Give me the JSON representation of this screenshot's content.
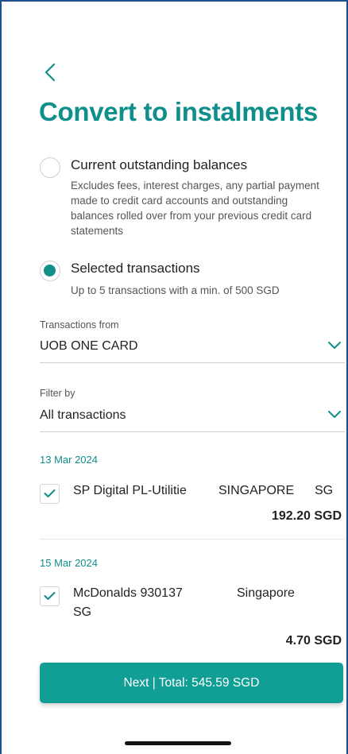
{
  "header": {
    "back_icon": "chevron-left-icon",
    "title": "Convert to instalments"
  },
  "options": [
    {
      "label": "Current outstanding balances",
      "description": "Excludes fees, interest charges, any partial payment made to credit card accounts and outstanding balances rolled over from your previous credit card statements",
      "selected": false
    },
    {
      "label": "Selected transactions",
      "description": "Up to 5 transactions with a min. of 500 SGD",
      "selected": true
    }
  ],
  "transactions_from": {
    "label": "Transactions from",
    "value": "UOB ONE CARD"
  },
  "filter": {
    "label": "Filter by",
    "value": "All transactions"
  },
  "transactions": [
    {
      "date": "13 Mar 2024",
      "merchant": "SP Digital PL-Utilitie",
      "location": "SINGAPORE",
      "country": "SG",
      "amount": "192.20 SGD",
      "checked": true
    },
    {
      "date": "15 Mar 2024",
      "merchant": "McDonalds 930137",
      "location": "Singapore",
      "country": "SG",
      "amount": "4.70 SGD",
      "checked": true
    }
  ],
  "footer": {
    "next_label": "Next | Total: 545.59 SGD"
  },
  "colors": {
    "accent": "#0f8f8a",
    "button": "#119e95"
  }
}
